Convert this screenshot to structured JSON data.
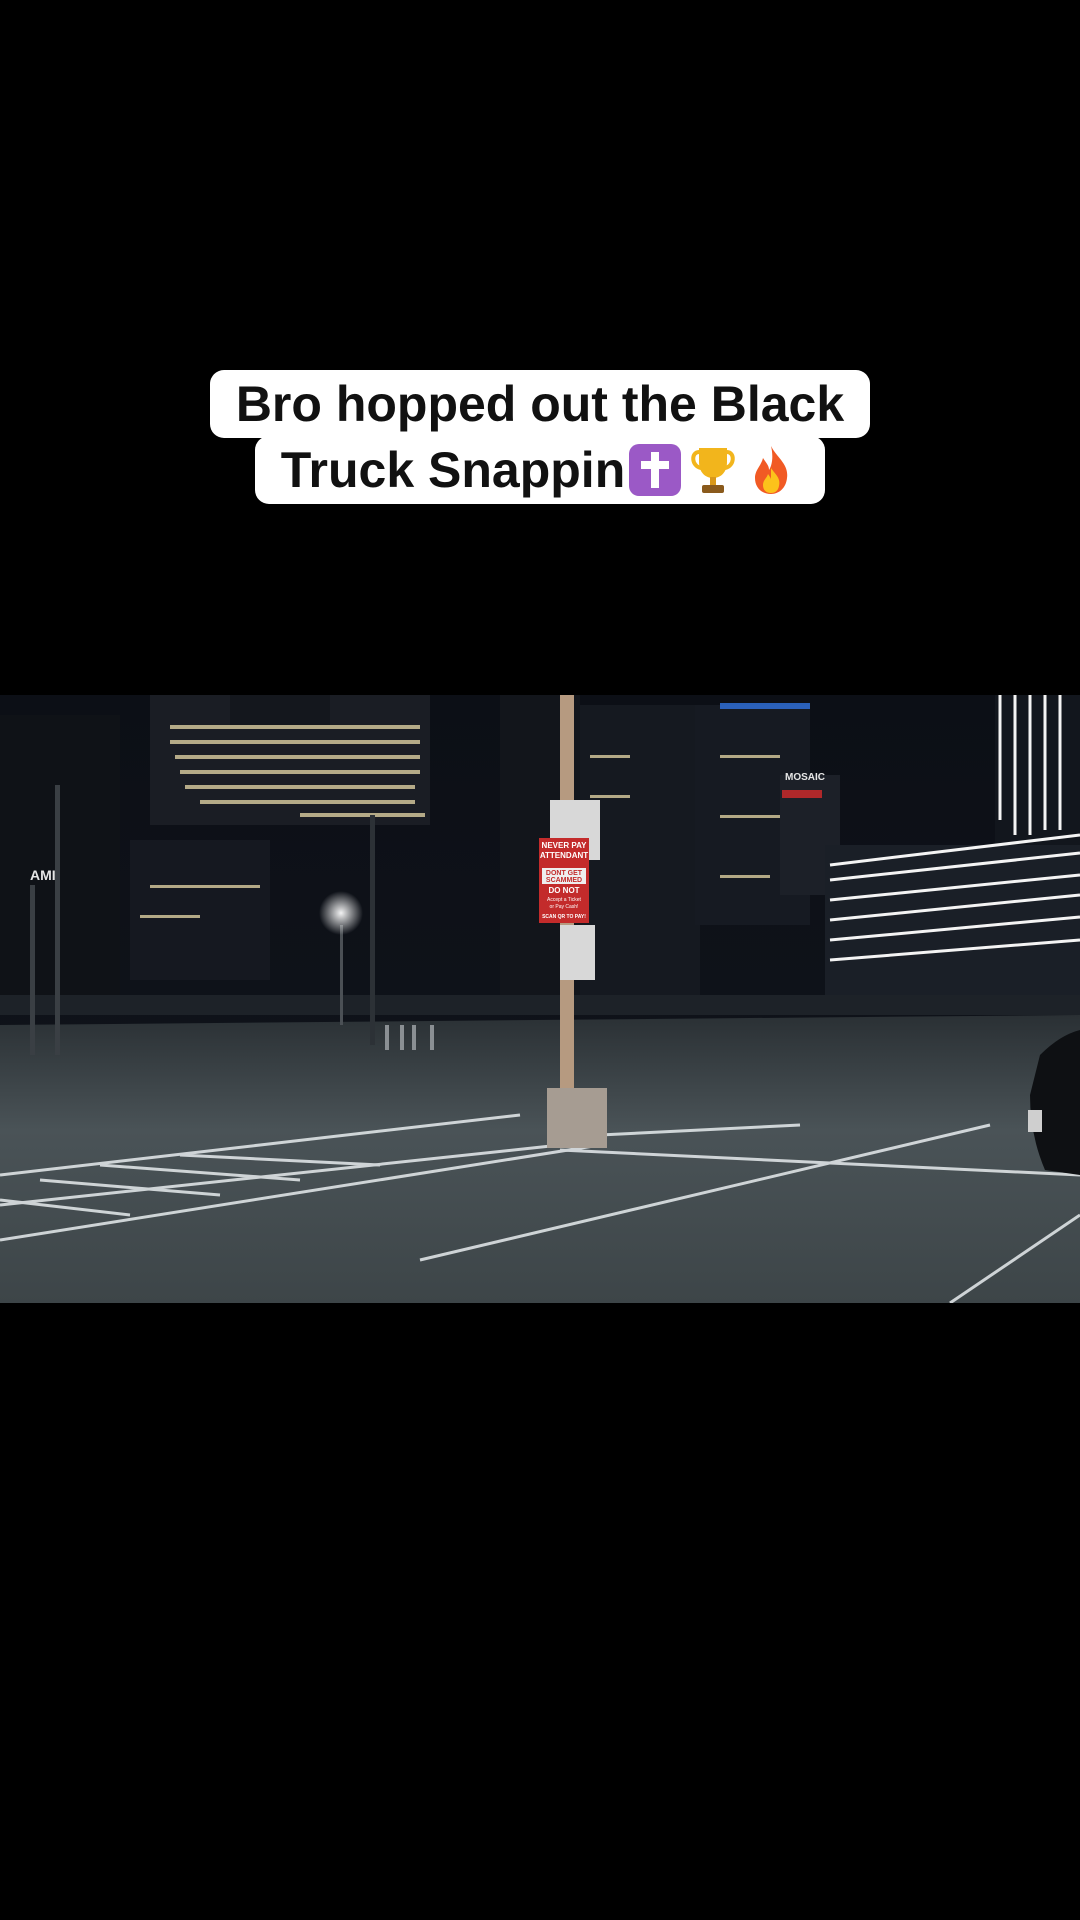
{
  "caption": {
    "line1": "Bro hopped out the Black",
    "line2": "Truck Snappin"
  },
  "emojis": [
    "latin-cross-emoji",
    "trophy-emoji",
    "fire-emoji"
  ],
  "scene": {
    "sign": {
      "line1": "NEVER PAY",
      "line2": "ATTENDANT",
      "line3": "DONT GET",
      "line4": "SCAMMED",
      "line5": "DO NOT",
      "line6": "Accept a Ticket",
      "line7": "or Pay Cash!",
      "line8": "SCAN QR TO PAY!"
    },
    "building_left_sign": "AMI",
    "building_right_sign": "MOSAIC"
  }
}
